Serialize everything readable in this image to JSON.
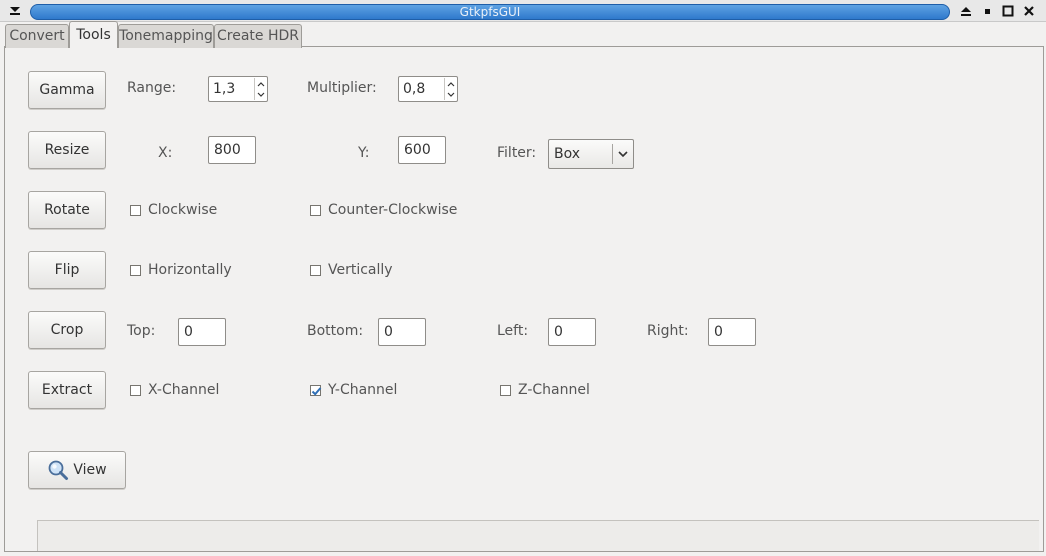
{
  "window": {
    "title": "GtkpfsGUI",
    "menu_icon": "window-menu-icon",
    "buttons": [
      "shade-icon",
      "minimize-icon",
      "maximize-icon",
      "close-icon"
    ]
  },
  "tabs": [
    {
      "label": "Convert",
      "active": false
    },
    {
      "label": "Tools",
      "active": true
    },
    {
      "label": "Tonemapping",
      "active": false
    },
    {
      "label": "Create HDR",
      "active": false
    }
  ],
  "gamma": {
    "button": "Gamma",
    "range_label": "Range:",
    "range_value": "1,3",
    "multiplier_label": "Multiplier:",
    "multiplier_value": "0,8"
  },
  "resize": {
    "button": "Resize",
    "x_label": "X:",
    "x_value": "800",
    "y_label": "Y:",
    "y_value": "600",
    "filter_label": "Filter:",
    "filter_value": "Box"
  },
  "rotate": {
    "button": "Rotate",
    "clockwise_label": "Clockwise",
    "clockwise_checked": false,
    "counter_label": "Counter-Clockwise",
    "counter_checked": false
  },
  "flip": {
    "button": "Flip",
    "horizontally_label": "Horizontally",
    "horizontally_checked": false,
    "vertically_label": "Vertically",
    "vertically_checked": false
  },
  "crop": {
    "button": "Crop",
    "top_label": "Top:",
    "top_value": "0",
    "bottom_label": "Bottom:",
    "bottom_value": "0",
    "left_label": "Left:",
    "left_value": "0",
    "right_label": "Right:",
    "right_value": "0"
  },
  "extract": {
    "button": "Extract",
    "x_label": "X-Channel",
    "x_checked": false,
    "y_label": "Y-Channel",
    "y_checked": true,
    "z_label": "Z-Channel",
    "z_checked": false
  },
  "view": {
    "button": "View",
    "icon": "magnifier-icon"
  },
  "colors": {
    "accent": "#2f79cc",
    "check": "#2f6fb6"
  }
}
